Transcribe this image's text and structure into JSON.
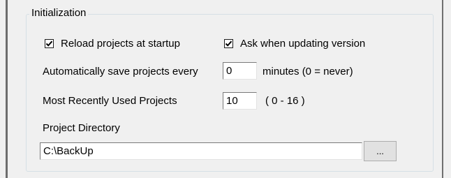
{
  "group": {
    "title": "Initialization"
  },
  "options": {
    "reload_projects": {
      "label": "Reload projects at startup",
      "checked": true
    },
    "ask_updating": {
      "label": "Ask when updating version",
      "checked": true
    }
  },
  "autosave": {
    "label": "Automatically save projects every",
    "value": "0",
    "unit_label": "minutes (0 = never)"
  },
  "mru": {
    "label": "Most Recently Used Projects",
    "value": "10",
    "range_label": "( 0 - 16 )"
  },
  "project_directory": {
    "label": "Project Directory",
    "value": "C:\\BackUp",
    "browse_label": "..."
  }
}
